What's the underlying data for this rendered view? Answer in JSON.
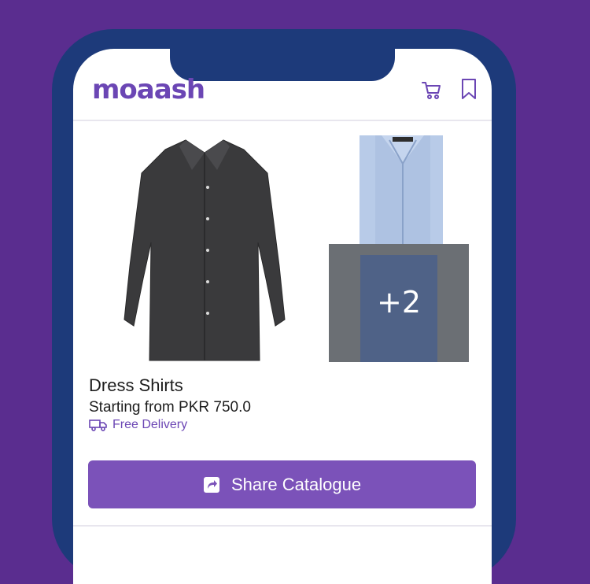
{
  "app": {
    "logo": "moaash"
  },
  "header": {
    "icons": [
      "cart-icon",
      "bookmark-icon"
    ]
  },
  "product": {
    "title": "Dress Shirts",
    "price": "Starting from PKR 750.0",
    "delivery": "Free Delivery",
    "more_images": "+2"
  },
  "actions": {
    "share_label": "Share Catalogue"
  },
  "colors": {
    "accent": "#6b46b4",
    "button": "#7b52b9",
    "frame": "#1d3a7a",
    "background": "#5a2d8f"
  }
}
